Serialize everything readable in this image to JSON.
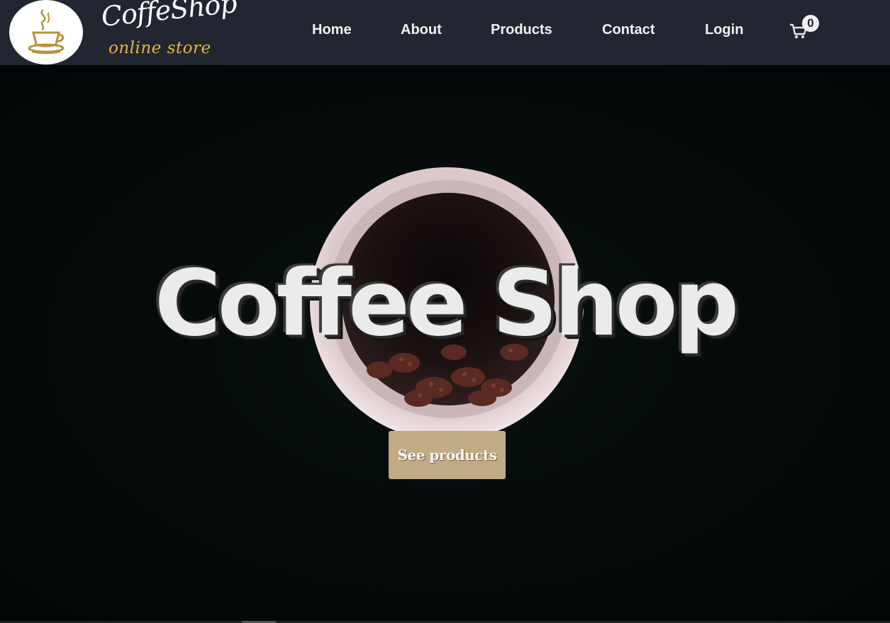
{
  "brand": {
    "title": "CoffeShop",
    "subtitle": "online store"
  },
  "nav": {
    "items": [
      {
        "label": "Home"
      },
      {
        "label": "About"
      },
      {
        "label": "Products"
      },
      {
        "label": "Contact"
      },
      {
        "label": "Login"
      }
    ]
  },
  "cart": {
    "count": "0",
    "icon": "cart-icon"
  },
  "hero": {
    "title": "Coffee Shop",
    "button_label": "See products"
  },
  "colors": {
    "navbar": "#222630",
    "accent": "#c1ab85",
    "brand_sub": "#e3b63e",
    "hero_bg": "#050a0a"
  }
}
